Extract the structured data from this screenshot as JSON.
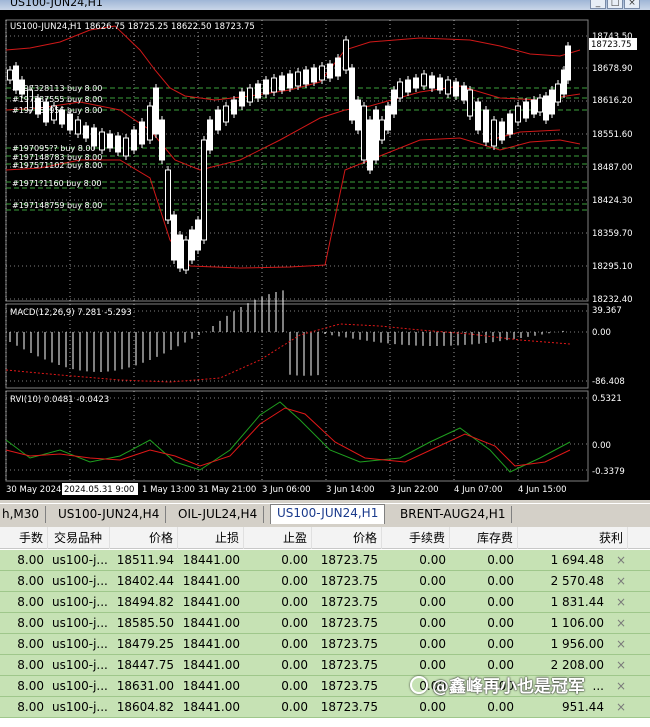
{
  "window": {
    "title": "US100-JUN24,H1",
    "buttons": [
      "_",
      "□",
      "×"
    ]
  },
  "chart": {
    "header": "US100-JUN24,H1  18626.75 18725.25 18622.50 18723.75",
    "current_price_tag": "18723.75",
    "price_axis": [
      "18743.50",
      "18678.90",
      "18616.20",
      "18551.60",
      "18487.00",
      "18424.30",
      "18359.70",
      "18295.10",
      "18232.40"
    ],
    "macd_label": "MACD(12,26,9) 7.281 -5.293",
    "macd_axis": [
      "39.367",
      "0.00",
      "-86.408"
    ],
    "rvi_label": "RVI(10) 0.0481 -0.0423",
    "rvi_axis": [
      "0.5321",
      "0.00",
      "-0.3379"
    ],
    "time_axis": [
      "30 May 2024",
      "2024.05.31 9:00",
      "1 May 13:00",
      "31 May 21:00",
      "3 Jun 06:00",
      "3 Jun 14:00",
      "3 Jun 22:00",
      "4 Jun 07:00",
      "4 Jun 15:00"
    ],
    "orders": [
      "#197328113 buy 8.00",
      "#197237555 buy 8.00",
      "#197168956 buy 8.00",
      "#197095?? buy 8.00",
      "#197148783 buy 8.00",
      "#197571102 buy 8.00",
      "#1971?1160 buy 8.00",
      "#197148759 buy 8.00"
    ]
  },
  "tabs": [
    "h,M30",
    "US100-JUN24,H4",
    "OIL-JUL24,H4",
    "US100-JUN24,H1",
    "BRENT-AUG24,H1"
  ],
  "active_tab": "US100-JUN24,H1",
  "table": {
    "headers": [
      "手数",
      "交易品种",
      "价格",
      "止损",
      "止盈",
      "价格",
      "手续费",
      "库存费",
      "获利"
    ],
    "rows": [
      {
        "lots": "8.00",
        "symbol": "us100-j...",
        "open": "18511.94",
        "sl": "18441.00",
        "tp": "0.00",
        "price": "18723.75",
        "fee": "0.00",
        "swap": "0.00",
        "profit": "1 694.48"
      },
      {
        "lots": "8.00",
        "symbol": "us100-j...",
        "open": "18402.44",
        "sl": "18441.00",
        "tp": "0.00",
        "price": "18723.75",
        "fee": "0.00",
        "swap": "0.00",
        "profit": "2 570.48"
      },
      {
        "lots": "8.00",
        "symbol": "us100-j...",
        "open": "18494.82",
        "sl": "18441.00",
        "tp": "0.00",
        "price": "18723.75",
        "fee": "0.00",
        "swap": "0.00",
        "profit": "1 831.44"
      },
      {
        "lots": "8.00",
        "symbol": "us100-j...",
        "open": "18585.50",
        "sl": "18441.00",
        "tp": "0.00",
        "price": "18723.75",
        "fee": "0.00",
        "swap": "0.00",
        "profit": "1 106.00"
      },
      {
        "lots": "8.00",
        "symbol": "us100-j...",
        "open": "18479.25",
        "sl": "18441.00",
        "tp": "0.00",
        "price": "18723.75",
        "fee": "0.00",
        "swap": "0.00",
        "profit": "1 956.00"
      },
      {
        "lots": "8.00",
        "symbol": "us100-j...",
        "open": "18447.75",
        "sl": "18441.00",
        "tp": "0.00",
        "price": "18723.75",
        "fee": "0.00",
        "swap": "0.00",
        "profit": "2 208.00"
      },
      {
        "lots": "8.00",
        "symbol": "us100-j...",
        "open": "18631.00",
        "sl": "18441.00",
        "tp": "0.00",
        "price": "18723.75",
        "fee": "0.00",
        "swap": "0.00",
        "profit": "..."
      },
      {
        "lots": "8.00",
        "symbol": "us100-j...",
        "open": "18604.82",
        "sl": "18441.00",
        "tp": "0.00",
        "price": "18723.75",
        "fee": "0.00",
        "swap": "0.00",
        "profit": "951.44"
      }
    ],
    "close_icon": "×"
  },
  "watermark": "@鑫峰再小也是冠军",
  "colors": {
    "bg": "#000000",
    "candle": "#ffffff",
    "bands": "#d01818",
    "order_line": "#3ca03c",
    "macd_signal": "#e01818",
    "rvi_main": "#1f9e1f",
    "rvi_signal": "#e01818",
    "row_bg": "#c6e2b4"
  }
}
